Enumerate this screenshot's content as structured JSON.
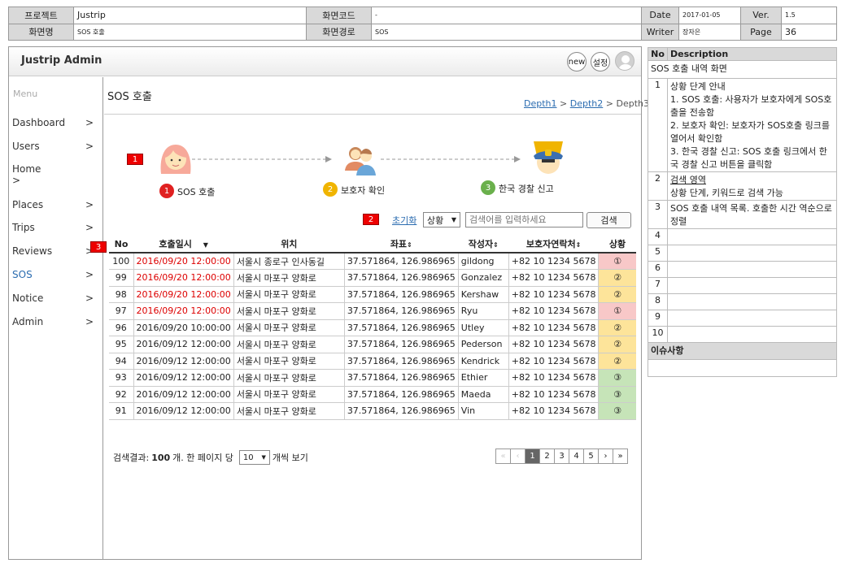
{
  "header": {
    "project_label": "프로젝트",
    "project_value": "Justrip",
    "screen_code_label": "화면코드",
    "screen_code_value": "-",
    "date_label": "Date",
    "date_value": "2017-01-05",
    "ver_label": "Ver.",
    "ver_value": "1.5",
    "screen_name_label": "화면명",
    "screen_name_value": "SOS 호출",
    "screen_path_label": "화면경로",
    "screen_path_value": "SOS",
    "writer_label": "Writer",
    "writer_value": "장자은",
    "page_label": "Page",
    "page_value": "36"
  },
  "app": {
    "title": "Justrip Admin",
    "new_label": "new",
    "settings_label": "설정"
  },
  "sidebar": {
    "heading": "Menu",
    "items": [
      {
        "label": "Dashboard",
        "arrow": ">"
      },
      {
        "label": "Users",
        "arrow": ">"
      },
      {
        "label": "Home",
        "arrow": ">"
      },
      {
        "label": "Places",
        "arrow": ">"
      },
      {
        "label": "Trips",
        "arrow": ">"
      },
      {
        "label": "Reviews",
        "arrow": ">"
      },
      {
        "label": "SOS",
        "arrow": ">"
      },
      {
        "label": "Notice",
        "arrow": ">"
      },
      {
        "label": "Admin",
        "arrow": ">"
      }
    ]
  },
  "page": {
    "title": "SOS 호출",
    "breadcrumb": {
      "d1": "Depth1",
      "sep": ">",
      "d2": "Depth2",
      "d3": "Depth3"
    }
  },
  "markers": {
    "m1": "1",
    "m2": "2",
    "m3": "3"
  },
  "steps": [
    {
      "num": "1",
      "label": "SOS 호출",
      "color": "#e02020"
    },
    {
      "num": "2",
      "label": "보호자 확인",
      "color": "#f0b400"
    },
    {
      "num": "3",
      "label": "한국 경찰 신고",
      "color": "#6ab04c"
    }
  ],
  "search": {
    "reset_label": "초기화",
    "status_select": "상황",
    "placeholder": "검색어를 입력하세요",
    "button_label": "검색"
  },
  "table": {
    "headers": [
      "No",
      "호출일시",
      "위치",
      "좌표",
      "작성자",
      "보호자연락처",
      "상황"
    ],
    "sort_icons": {
      "time": "▼",
      "coord": "⇕",
      "writer": "⇕",
      "contact": "⇕"
    },
    "rows": [
      {
        "no": "100",
        "time": "2016/09/20 12:00:00",
        "loc": "서울시 종로구 인사동길",
        "coord": "37.571864, 126.986965",
        "writer": "gildong",
        "contact": "+82 10 1234 5678",
        "status": "①",
        "level": 1,
        "urgent": true
      },
      {
        "no": "99",
        "time": "2016/09/20 12:00:00",
        "loc": "서울시 마포구 양화로",
        "coord": "37.571864, 126.986965",
        "writer": "Gonzalez",
        "contact": "+82 10 1234 5678",
        "status": "②",
        "level": 2,
        "urgent": true
      },
      {
        "no": "98",
        "time": "2016/09/20 12:00:00",
        "loc": "서울시 마포구 양화로",
        "coord": "37.571864, 126.986965",
        "writer": "Kershaw",
        "contact": "+82 10 1234 5678",
        "status": "②",
        "level": 2,
        "urgent": true
      },
      {
        "no": "97",
        "time": "2016/09/20 12:00:00",
        "loc": "서울시 마포구 양화로",
        "coord": "37.571864, 126.986965",
        "writer": "Ryu",
        "contact": "+82 10 1234 5678",
        "status": "①",
        "level": 1,
        "urgent": true
      },
      {
        "no": "96",
        "time": "2016/09/20 10:00:00",
        "loc": "서울시 마포구 양화로",
        "coord": "37.571864, 126.986965",
        "writer": "Utley",
        "contact": "+82 10 1234 5678",
        "status": "②",
        "level": 2,
        "urgent": false
      },
      {
        "no": "95",
        "time": "2016/09/12 12:00:00",
        "loc": "서울시 마포구 양화로",
        "coord": "37.571864, 126.986965",
        "writer": "Pederson",
        "contact": "+82 10 1234 5678",
        "status": "②",
        "level": 2,
        "urgent": false
      },
      {
        "no": "94",
        "time": "2016/09/12 12:00:00",
        "loc": "서울시 마포구 양화로",
        "coord": "37.571864, 126.986965",
        "writer": "Kendrick",
        "contact": "+82 10 1234 5678",
        "status": "②",
        "level": 2,
        "urgent": false
      },
      {
        "no": "93",
        "time": "2016/09/12 12:00:00",
        "loc": "서울시 마포구 양화로",
        "coord": "37.571864, 126.986965",
        "writer": "Ethier",
        "contact": "+82 10 1234 5678",
        "status": "③",
        "level": 3,
        "urgent": false
      },
      {
        "no": "92",
        "time": "2016/09/12 12:00:00",
        "loc": "서울시 마포구 양화로",
        "coord": "37.571864, 126.986965",
        "writer": "Maeda",
        "contact": "+82 10 1234 5678",
        "status": "③",
        "level": 3,
        "urgent": false
      },
      {
        "no": "91",
        "time": "2016/09/12 12:00:00",
        "loc": "서울시 마포구 양화로",
        "coord": "37.571864, 126.986965",
        "writer": "Vin",
        "contact": "+82 10 1234 5678",
        "status": "③",
        "level": 3,
        "urgent": false
      }
    ]
  },
  "footer": {
    "result_prefix": "검색결과:",
    "result_count": "100",
    "result_mid": "개. 한 페이지 당",
    "per_page": "10",
    "result_suffix": "개씩 보기",
    "pages": [
      "«",
      "‹",
      "1",
      "2",
      "3",
      "4",
      "5",
      "›",
      "»"
    ],
    "current_page": "1"
  },
  "description": {
    "no_header": "No",
    "desc_header": "Description",
    "title": "SOS 호출 내역 화면",
    "items": [
      {
        "no": "1",
        "lines": [
          "상황 단계 안내",
          "1. SOS 호출: 사용자가 보호자에게 SOS호출을 전송함",
          "2. 보호자 확인: 보호자가 SOS호출 링크를 열어서 확인함",
          "3. 한국 경찰 신고: SOS 호출 링크에서 한국 경찰 신고 버튼을 클릭함"
        ]
      },
      {
        "no": "2",
        "lines": [
          "검색 영역",
          "상황 단계, 키워드로 검색 가능"
        ]
      },
      {
        "no": "3",
        "lines": [
          "SOS 호출 내역 목록. 호출한 시간 역순으로 정렬"
        ]
      },
      {
        "no": "4",
        "lines": []
      },
      {
        "no": "5",
        "lines": []
      },
      {
        "no": "6",
        "lines": []
      },
      {
        "no": "7",
        "lines": []
      },
      {
        "no": "8",
        "lines": []
      },
      {
        "no": "9",
        "lines": []
      },
      {
        "no": "10",
        "lines": []
      }
    ],
    "issues_label": "이슈사항"
  }
}
